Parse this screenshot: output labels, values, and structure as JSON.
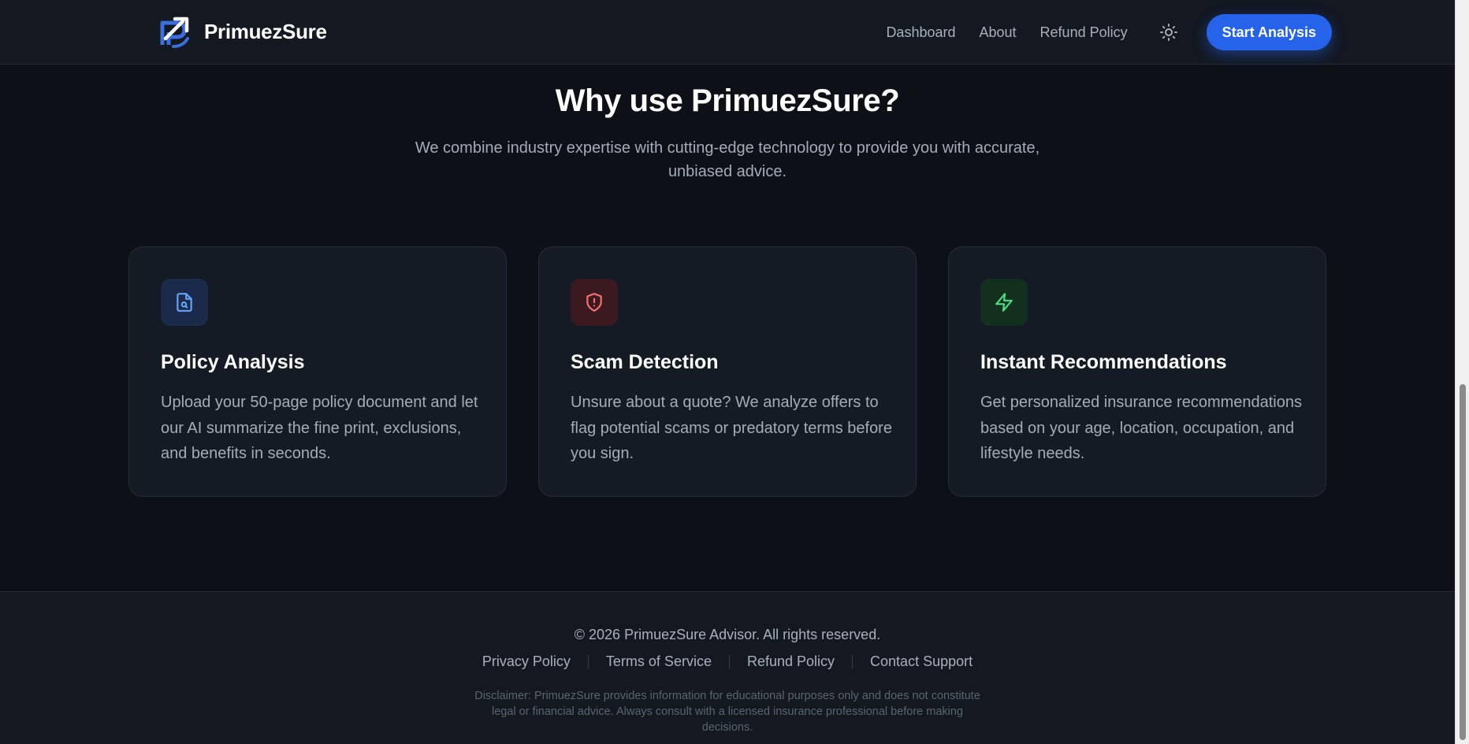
{
  "header": {
    "brand_name": "PrimuezSure",
    "nav": [
      "Dashboard",
      "About",
      "Refund Policy"
    ],
    "cta_label": "Start Analysis"
  },
  "hero": {
    "title": "Why use PrimuezSure?",
    "subtitle": "We combine industry expertise with cutting-edge technology to provide you with accurate, unbiased advice."
  },
  "features": [
    {
      "icon": "file-search-icon",
      "title": "Policy Analysis",
      "text": "Upload your 50-page policy document and let our AI summarize the fine print, exclusions, and benefits in seconds."
    },
    {
      "icon": "shield-alert-icon",
      "title": "Scam Detection",
      "text": "Unsure about a quote? We analyze offers to flag potential scams or predatory terms before you sign."
    },
    {
      "icon": "lightning-icon",
      "title": "Instant Recommendations",
      "text": "Get personalized insurance recommendations based on your age, location, occupation, and lifestyle needs."
    }
  ],
  "footer": {
    "copyright": "© 2026 PrimuezSure Advisor. All rights reserved.",
    "links": [
      "Privacy Policy",
      "Terms of Service",
      "Refund Policy",
      "Contact Support"
    ],
    "disclaimer": "Disclaimer: PrimuezSure provides information for educational purposes only and does not constitute legal or financial advice. Always consult with a licensed insurance professional before making decisions."
  },
  "colors": {
    "background": "#0d1117",
    "surface": "#151b25",
    "accent": "#2563eb",
    "icon_blue": "#60a5fa",
    "icon_red": "#f87171",
    "icon_green": "#4ade80"
  }
}
